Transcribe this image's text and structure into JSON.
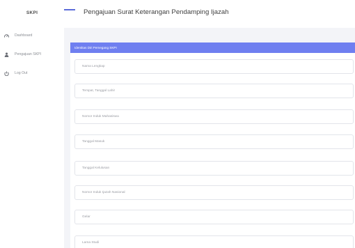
{
  "sidebar": {
    "brand": "SKPI",
    "items": [
      {
        "label": "Dashboard",
        "icon": "tachometer-icon"
      },
      {
        "label": "Pengajuan SKPI",
        "icon": "user-icon"
      },
      {
        "label": "Log Out",
        "icon": "power-icon"
      }
    ]
  },
  "header": {
    "title": "Pengajuan Surat Keterangan Pendamping Ijazah"
  },
  "card": {
    "title": "Identitas Diri Pemegang SKPI",
    "fields": [
      {
        "placeholder": "Nama Lengkap"
      },
      {
        "placeholder": "Tempat, Tanggal Lahir"
      },
      {
        "placeholder": "Nomor Induk Mahasiswa"
      },
      {
        "placeholder": "Tanggal Masuk"
      },
      {
        "placeholder": "Tanggal Kelulusan"
      },
      {
        "placeholder": "Nomor Induk Ijazah Nasional"
      },
      {
        "placeholder": "Gelar"
      },
      {
        "placeholder": "Lama Studi"
      }
    ]
  },
  "colors": {
    "accent": "#6f7ff0",
    "background": "#f3f4f8"
  }
}
